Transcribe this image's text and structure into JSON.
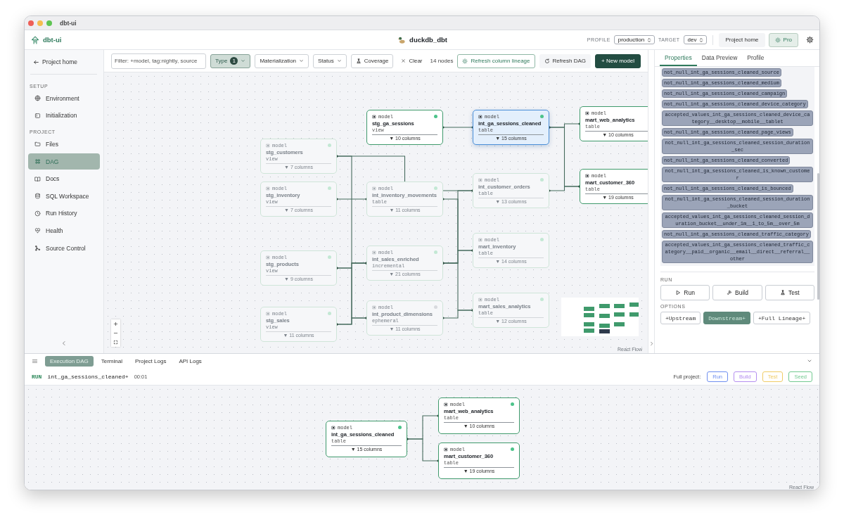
{
  "window": {
    "title": "dbt-ui"
  },
  "header": {
    "app_name": "dbt-ui",
    "project": "duckdb_dbt",
    "profile_label": "PROFILE",
    "profile": "production",
    "target_label": "TARGET",
    "target": "dev",
    "buttons": [
      {
        "label": "Project home",
        "kind": "plain"
      },
      {
        "label": "Pro",
        "kind": "pro"
      }
    ]
  },
  "sidebar": {
    "back": "Project home",
    "sections": [
      {
        "title": "SETUP",
        "items": [
          {
            "label": "Environment",
            "selected": false
          },
          {
            "label": "Initialization",
            "selected": false
          }
        ]
      },
      {
        "title": "PROJECT",
        "items": [
          {
            "label": "Files",
            "selected": false
          },
          {
            "label": "DAG",
            "selected": true
          },
          {
            "label": "Docs",
            "selected": false
          },
          {
            "label": "SQL Workspace",
            "selected": false
          },
          {
            "label": "Run History",
            "selected": false
          },
          {
            "label": "Health",
            "selected": false
          },
          {
            "label": "Source Control",
            "selected": false
          }
        ]
      }
    ]
  },
  "toolbar": {
    "filter_placeholder": "Filter: +model, tag:nightly, source",
    "filters": [
      {
        "label": "Type",
        "count": "1",
        "active": true
      },
      {
        "label": "Materialization",
        "active": false
      },
      {
        "label": "Status",
        "active": false
      }
    ],
    "coverage": "Coverage",
    "clear": "Clear",
    "node_count": "14 nodes",
    "actions": [
      {
        "label": "Refresh column lineage",
        "kind": "outline"
      },
      {
        "label": "Refresh DAG",
        "kind": "plain"
      },
      {
        "label": "+ New model",
        "kind": "primary"
      }
    ]
  },
  "dag": {
    "nodes": [
      {
        "type": "model",
        "name": "stg_ga_sessions",
        "materialization": "view",
        "columns": "▼ 10 columns",
        "faded": false,
        "selected": false,
        "color": "#4cc38a"
      },
      {
        "type": "model",
        "name": "int_ga_sessions_cleaned",
        "materialization": "table",
        "columns": "▼ 15 columns",
        "faded": false,
        "selected": true,
        "color": "#4cc38a"
      },
      {
        "type": "model",
        "name": "mart_web_analytics",
        "materialization": "table",
        "columns": "▼ 10 columns",
        "faded": false,
        "selected": false
      },
      {
        "type": "model",
        "name": "mart_customer_360",
        "materialization": "table",
        "columns": "▼ 19 columns",
        "faded": false,
        "selected": false
      },
      {
        "type": "model",
        "name": "stg_customers",
        "materialization": "view",
        "columns": "▼ 7 columns",
        "faded": true,
        "selected": false,
        "color": "#c3e8d4"
      },
      {
        "type": "model",
        "name": "stg_inventory",
        "materialization": "view",
        "columns": "▼ 7 columns",
        "faded": true,
        "selected": false,
        "color": "#c3e8d4"
      },
      {
        "type": "model",
        "name": "int_inventory_movements",
        "materialization": "table",
        "columns": "▼ 11 columns",
        "faded": true,
        "selected": false,
        "color": "#c3e8d4"
      },
      {
        "type": "model",
        "name": "int_customer_orders",
        "materialization": "table",
        "columns": "▼ 13 columns",
        "faded": true,
        "selected": false,
        "color": "#c3e8d4"
      },
      {
        "type": "model",
        "name": "mart_inventory",
        "materialization": "table",
        "columns": "▼ 14 columns",
        "faded": true,
        "selected": false,
        "color": "#c3e8d4"
      },
      {
        "type": "model",
        "name": "stg_products",
        "materialization": "view",
        "columns": "▼ 9 columns",
        "faded": true,
        "selected": false,
        "color": "#c3e8d4"
      },
      {
        "type": "model",
        "name": "int_sales_enriched",
        "materialization": "incremental",
        "columns": "▼ 21 columns",
        "faded": true,
        "selected": false,
        "color": "#c3e8d4"
      },
      {
        "type": "model",
        "name": "mart_sales_analytics",
        "materialization": "table",
        "columns": "▼ 12 columns",
        "faded": true,
        "selected": false,
        "color": "#c3e8d4"
      },
      {
        "type": "model",
        "name": "stg_sales",
        "materialization": "view",
        "columns": "▼ 11 columns",
        "faded": true,
        "selected": false,
        "color": "#c3e8d4"
      },
      {
        "type": "model",
        "name": "int_product_dimensions",
        "materialization": "ephemeral",
        "columns": "▼ 11 columns",
        "faded": true,
        "selected": false,
        "color": "#d8dade"
      }
    ],
    "attribution": "React Flow"
  },
  "properties": {
    "tabs": [
      {
        "label": "Properties",
        "selected": true
      },
      {
        "label": "Data Preview",
        "selected": false
      },
      {
        "label": "Profile",
        "selected": false
      }
    ],
    "tests": [
      "not_null_int_ga_sessions_cleaned_source",
      "not_null_int_ga_sessions_cleaned_medium",
      "not_null_int_ga_sessions_cleaned_campaign",
      "not_null_int_ga_sessions_cleaned_device_category",
      "accepted_values_int_ga_sessions_cleaned_device_category__desktop__mobile__tablet",
      "not_null_int_ga_sessions_cleaned_page_views",
      "not_null_int_ga_sessions_cleaned_session_duration_sec",
      "not_null_int_ga_sessions_cleaned_converted",
      "not_null_int_ga_sessions_cleaned_is_known_customer",
      "not_null_int_ga_sessions_cleaned_is_bounced",
      "not_null_int_ga_sessions_cleaned_session_duration_bucket",
      "accepted_values_int_ga_sessions_cleaned_session_duration_bucket__under_1m__1_to_5m__over_5m",
      "not_null_int_ga_sessions_cleaned_traffic_category",
      "accepted_values_int_ga_sessions_cleaned_traffic_category__paid__organic__email__direct__referral__other"
    ],
    "run_title": "RUN",
    "run_buttons": [
      "Run",
      "Build",
      "Test"
    ],
    "options_title": "OPTIONS",
    "options": [
      {
        "label": "+Upstream",
        "selected": false
      },
      {
        "label": "Downstream+",
        "selected": true
      },
      {
        "label": "+Full Lineage+",
        "selected": false
      }
    ]
  },
  "bottom_panel": {
    "tabs": [
      {
        "label": "Execution DAG",
        "selected": true
      },
      {
        "label": "Terminal",
        "selected": false
      },
      {
        "label": "Project Logs",
        "selected": false
      },
      {
        "label": "API Logs",
        "selected": false
      }
    ],
    "run": {
      "label": "RUN",
      "selector": "int_ga_sessions_cleaned+",
      "elapsed": "00:01"
    },
    "full_project_label": "Full project:",
    "project_buttons": [
      {
        "label": "Run",
        "color": "#6f8ff0"
      },
      {
        "label": "Build",
        "color": "#b48ef0"
      },
      {
        "label": "Test",
        "color": "#f0cc66"
      },
      {
        "label": "Seed",
        "color": "#72c990"
      }
    ],
    "nodes": [
      {
        "type": "model",
        "name": "int_ga_sessions_cleaned",
        "materialization": "table",
        "columns": "▼ 15 columns",
        "color": "#4cc38a"
      },
      {
        "type": "model",
        "name": "mart_web_analytics",
        "materialization": "table",
        "columns": "▼ 10 columns",
        "color": "#4cc38a"
      },
      {
        "type": "model",
        "name": "mart_customer_360",
        "materialization": "table",
        "columns": "▼ 19 columns",
        "color": "#4cc38a"
      }
    ],
    "attribution": "React Flow"
  }
}
